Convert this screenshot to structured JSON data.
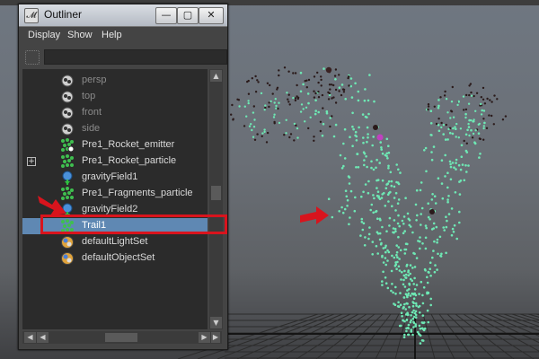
{
  "outliner": {
    "title": "Outliner",
    "window_buttons": {
      "minimize": "—",
      "maximize": "▢",
      "close": "✕"
    },
    "menu": [
      "Display",
      "Show",
      "Help"
    ],
    "search": {
      "value": "",
      "placeholder": ""
    },
    "items": [
      {
        "label": "persp",
        "icon": "camera-icon",
        "dim": true,
        "expandable": false,
        "selected": false
      },
      {
        "label": "top",
        "icon": "camera-icon",
        "dim": true,
        "expandable": false,
        "selected": false
      },
      {
        "label": "front",
        "icon": "camera-icon",
        "dim": true,
        "expandable": false,
        "selected": false
      },
      {
        "label": "side",
        "icon": "camera-icon",
        "dim": true,
        "expandable": false,
        "selected": false
      },
      {
        "label": "Pre1_Rocket_emitter",
        "icon": "emitter-icon",
        "dim": false,
        "expandable": false,
        "selected": false
      },
      {
        "label": "Pre1_Rocket_particle",
        "icon": "particle-icon",
        "dim": false,
        "expandable": true,
        "selected": false
      },
      {
        "label": "gravityField1",
        "icon": "gravity-field-icon",
        "dim": false,
        "expandable": false,
        "selected": false
      },
      {
        "label": "Pre1_Fragments_particle",
        "icon": "particle-icon",
        "dim": false,
        "expandable": false,
        "selected": false
      },
      {
        "label": "gravityField2",
        "icon": "gravity-field-icon",
        "dim": false,
        "expandable": false,
        "selected": false
      },
      {
        "label": "Trail1",
        "icon": "particle-icon",
        "dim": false,
        "expandable": false,
        "selected": true
      },
      {
        "label": "defaultLightSet",
        "icon": "set-icon",
        "dim": false,
        "expandable": false,
        "selected": false
      },
      {
        "label": "defaultObjectSet",
        "icon": "set-icon",
        "dim": false,
        "expandable": false,
        "selected": false
      }
    ]
  },
  "colors": {
    "selection": "#5f88b3",
    "annotation_red": "#d8141d",
    "particle_green": "#6ee8b4",
    "particle_dark": "#2a1a1a"
  }
}
